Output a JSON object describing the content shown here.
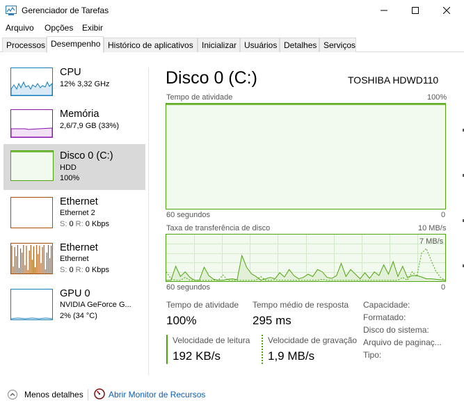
{
  "window": {
    "title": "Gerenciador de Tarefas",
    "minimize_symbol": "—",
    "close_symbol": "✕"
  },
  "menu": [
    "Arquivo",
    "Opções",
    "Exibir"
  ],
  "tabs": [
    {
      "label": "Processos"
    },
    {
      "label": "Desempenho",
      "active": true
    },
    {
      "label": "Histórico de aplicativos"
    },
    {
      "label": "Inicializar"
    },
    {
      "label": "Usuários"
    },
    {
      "label": "Detalhes"
    },
    {
      "label": "Serviços"
    }
  ],
  "sidebar": {
    "items": [
      {
        "title": "CPU",
        "line1": "12% 3,32 GHz",
        "color": "#117dbb"
      },
      {
        "title": "Memória",
        "line1": "2,6/7,9 GB (33%)",
        "color": "#8b12ae"
      },
      {
        "title": "Disco 0 (C:)",
        "line1": "HDD",
        "line2": "100%",
        "color": "#4da60c",
        "active": true
      },
      {
        "title": "Ethernet",
        "line1": "Ethernet 2",
        "s_label": "S:",
        "s_value": "0",
        "r_label": "R:",
        "r_value": "0 Kbps",
        "color": "#a74f01"
      },
      {
        "title": "Ethernet",
        "line1": "Ethernet",
        "s_label": "S:",
        "s_value": "0",
        "r_label": "R:",
        "r_value": "0 Kbps",
        "color": "#a74f01"
      },
      {
        "title": "GPU 0",
        "line1": "NVIDIA GeForce G...",
        "line2": "2% (34 °C)",
        "color": "#117dbb"
      }
    ]
  },
  "main": {
    "title": "Disco 0 (C:)",
    "model": "TOSHIBA HDWD110",
    "graph1": {
      "label": "Tempo de atividade",
      "max_label": "100%",
      "time_label": "60 segundos",
      "min_label": "0",
      "series": [
        100,
        100,
        100,
        100,
        100,
        100,
        100,
        100,
        100,
        100,
        100,
        100,
        100,
        100,
        100,
        100,
        100,
        100,
        100,
        100,
        100,
        100,
        100,
        100,
        100,
        100,
        100,
        100,
        100,
        100,
        100,
        100,
        100,
        100,
        100,
        100,
        100,
        100,
        100,
        100,
        100,
        100,
        100,
        100,
        100,
        100,
        100,
        100,
        100,
        100,
        100,
        100,
        100,
        100,
        100,
        100,
        100,
        100,
        100,
        100
      ]
    },
    "graph2": {
      "label": "Taxa de transferência de disco",
      "max_label": "10 MB/s",
      "inner_label": "7 MB/s",
      "time_label": "60 segundos",
      "min_label": "0",
      "max_value": 10,
      "read_series": [
        0.2,
        0.2,
        3.2,
        1.0,
        2.0,
        0.8,
        0.2,
        0.2,
        3.0,
        1.2,
        0.4,
        0.2,
        0.2,
        0.4,
        0.5,
        0.3,
        5.5,
        3.0,
        1.6,
        1.0,
        0.2,
        0.5,
        0.8,
        0.5,
        1.8,
        0.9,
        2.5,
        1.2,
        0.5,
        0.8,
        1.5,
        1.0,
        2.5,
        2.0,
        0.8,
        0.6,
        1.2,
        3.8,
        1.0,
        2.5,
        1.5,
        0.5,
        1.8,
        0.6,
        2.0,
        1.2,
        3.5,
        1.5,
        4.2,
        1.0,
        3.2,
        0.8,
        1.2,
        1.2,
        0.9,
        0.5,
        0.5,
        0.4,
        0.3,
        0.2
      ],
      "write_series": [
        2.0,
        0.5,
        0.2,
        0.2,
        0.8,
        0.2,
        0.2,
        0.2,
        0.2,
        0.2,
        0.2,
        0.2,
        1.3,
        0.2,
        0.2,
        0.2,
        0.2,
        0.2,
        0.2,
        0.2,
        1.0,
        0.2,
        0.2,
        0.3,
        0.2,
        0.2,
        0.2,
        0.2,
        0.2,
        0.2,
        0.2,
        0.2,
        0.2,
        0.4,
        0.2,
        0.2,
        0.2,
        0.2,
        0.2,
        0.2,
        0.2,
        0.2,
        0.2,
        0.2,
        0.2,
        0.2,
        0.2,
        0.2,
        0.2,
        0.2,
        0.8,
        0.2,
        2.0,
        1.0,
        6.0,
        7.0,
        4.5,
        2.2,
        0.8,
        0.2
      ]
    },
    "stats": {
      "active_time_label": "Tempo de atividade",
      "active_time_value": "100%",
      "response_label": "Tempo médio de resposta",
      "response_value": "295 ms",
      "read_label": "Velocidade de leitura",
      "read_value": "192 KB/s",
      "write_label": "Velocidade de gravação",
      "write_value": "1,9 MB/s"
    },
    "properties": [
      "Capacidade:",
      "Formatado:",
      "Disco do sistema:",
      "Arquivo de paginaç...",
      "Tipo:"
    ]
  },
  "footer": {
    "fewer_details": "Menos detalhes",
    "open_monitor": "Abrir Monitor de Recursos"
  },
  "colors": {
    "disk": "#4da60c",
    "cpu": "#117dbb",
    "memory": "#8b12ae",
    "ethernet": "#a74f01",
    "link": "#0b5fb7"
  }
}
